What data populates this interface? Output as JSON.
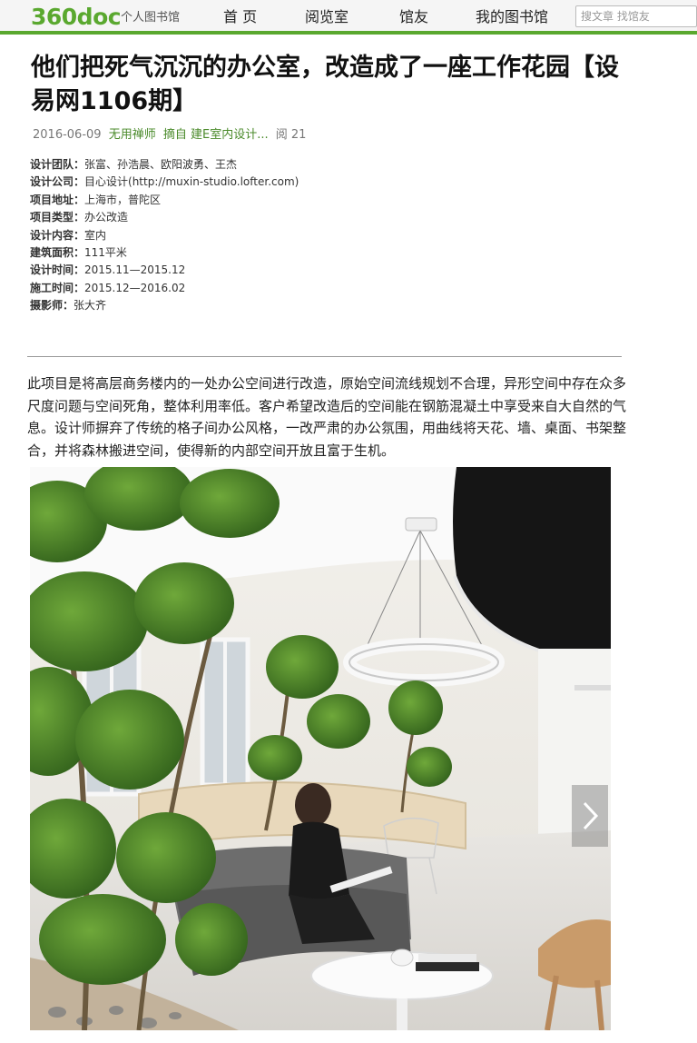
{
  "header": {
    "logo": "360doc",
    "logo_sub": "个人图书馆",
    "nav": [
      "首 页",
      "阅览室",
      "馆友",
      "我的图书馆"
    ],
    "search_placeholder": "搜文章 找馆友"
  },
  "article": {
    "title": "他们把死气沉沉的办公室，改造成了一座工作花园【设易网1106期】",
    "meta": {
      "date": "2016-06-09",
      "author": "无用禅师",
      "source": "摘自 建E室内设计...",
      "reads": "阅 21"
    },
    "info": [
      {
        "label": "设计团队：",
        "value": "张富、孙浩晨、欧阳波勇、王杰"
      },
      {
        "label": "设计公司：",
        "value": "目心设计(http://muxin-studio.lofter.com)"
      },
      {
        "label": "项目地址：",
        "value": "上海市，普陀区"
      },
      {
        "label": "项目类型：",
        "value": "办公改造"
      },
      {
        "label": "设计内容：",
        "value": "室内"
      },
      {
        "label": "建筑面积：",
        "value": "111平米"
      },
      {
        "label": "设计时间：",
        "value": "2015.11—2015.12"
      },
      {
        "label": "施工时间：",
        "value": "2015.12—2016.02"
      },
      {
        "label": "摄影师：",
        "value": "张大齐"
      }
    ],
    "paragraph": "此项目是将高层商务楼内的一处办公空间进行改造，原始空间流线规划不合理，异形空间中存在众多尺度问题与空间死角，整体利用率低。客户希望改造后的空间能在钢筋混凝土中享受来自大自然的气息。设计师摒弃了传统的格子间办公风格，一改严肃的办公氛围，用曲线将天花、墙、桌面、书架整合，并将森林搬进空间，使得新的内部空间开放且富于生机。"
  },
  "colors": {
    "brand_green": "#5aa82f",
    "link_green": "#4a8a2a"
  },
  "icons": {
    "next": "chevron-right-icon"
  }
}
